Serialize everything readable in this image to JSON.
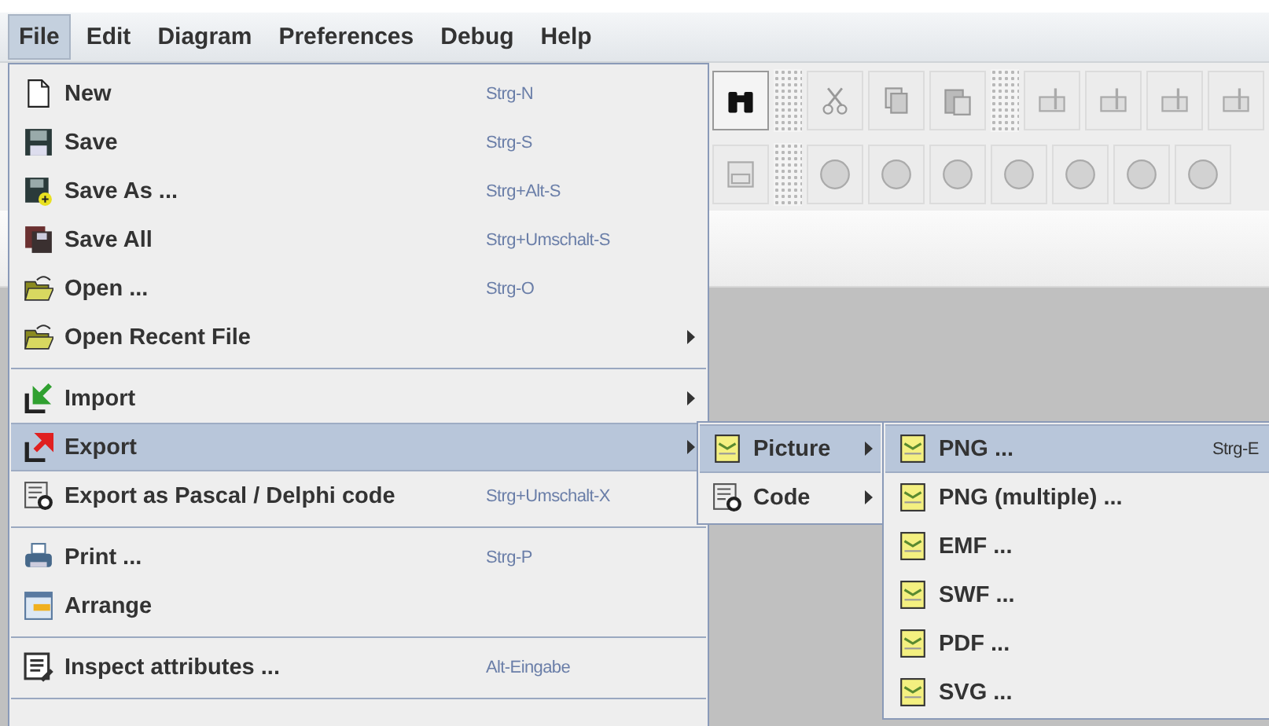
{
  "menubar": [
    {
      "label": "File",
      "selected": true
    },
    {
      "label": "Edit",
      "selected": false
    },
    {
      "label": "Diagram",
      "selected": false
    },
    {
      "label": "Preferences",
      "selected": false
    },
    {
      "label": "Debug",
      "selected": false
    },
    {
      "label": "Help",
      "selected": false
    }
  ],
  "file_menu": [
    {
      "kind": "item",
      "label": "New",
      "shortcut": "Strg-N",
      "selected": false
    },
    {
      "kind": "item",
      "label": "Save",
      "shortcut": "Strg-S",
      "selected": false
    },
    {
      "kind": "item",
      "label": "Save As ...",
      "shortcut": "Strg+Alt-S",
      "selected": false
    },
    {
      "kind": "item",
      "label": "Save All",
      "shortcut": "Strg+Umschalt-S",
      "selected": false
    },
    {
      "kind": "item",
      "label": "Open ...",
      "shortcut": "Strg-O",
      "selected": false
    },
    {
      "kind": "submenu",
      "label": "Open Recent File",
      "selected": false
    },
    {
      "kind": "separator"
    },
    {
      "kind": "submenu",
      "label": "Import",
      "selected": false
    },
    {
      "kind": "submenu",
      "label": "Export",
      "selected": true
    },
    {
      "kind": "item",
      "label": "Export as Pascal / Delphi code",
      "shortcut": "Strg+Umschalt-X",
      "selected": false
    },
    {
      "kind": "separator"
    },
    {
      "kind": "item",
      "label": "Print ...",
      "shortcut": "Strg-P",
      "selected": false
    },
    {
      "kind": "item",
      "label": "Arrange",
      "selected": false
    },
    {
      "kind": "separator"
    },
    {
      "kind": "item",
      "label": "Inspect attributes ...",
      "shortcut": "Alt-Eingabe",
      "selected": false
    },
    {
      "kind": "separator"
    }
  ],
  "export_submenu": [
    {
      "kind": "submenu",
      "label": "Picture",
      "selected": true
    },
    {
      "kind": "submenu",
      "label": "Code",
      "selected": false
    }
  ],
  "picture_submenu": [
    {
      "kind": "item",
      "label": "PNG ...",
      "shortcut": "Strg-E",
      "selected": true
    },
    {
      "kind": "item",
      "label": "PNG (multiple) ...",
      "selected": false
    },
    {
      "kind": "item",
      "label": "EMF ...",
      "selected": false
    },
    {
      "kind": "item",
      "label": "SWF ...",
      "selected": false
    },
    {
      "kind": "item",
      "label": "PDF ...",
      "selected": false
    },
    {
      "kind": "item",
      "label": "SVG ...",
      "selected": false
    }
  ]
}
